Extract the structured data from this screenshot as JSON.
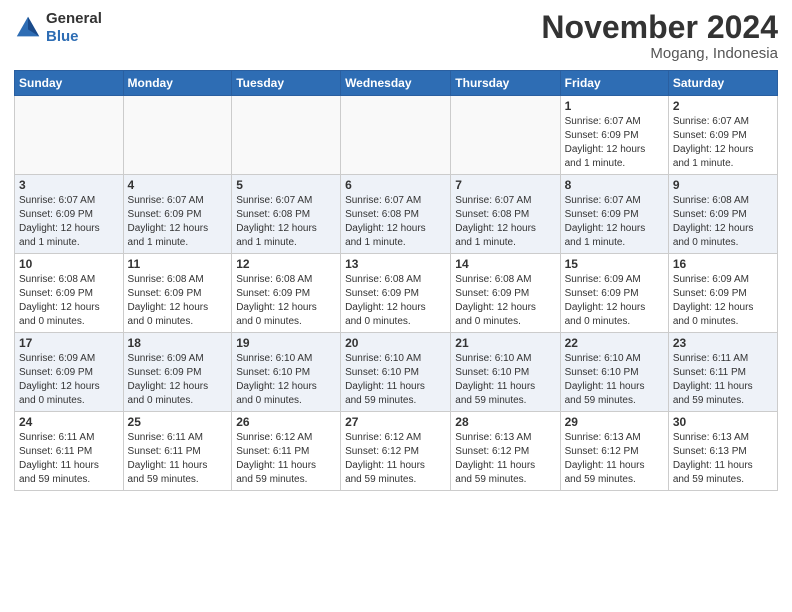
{
  "logo": {
    "line1": "General",
    "line2": "Blue"
  },
  "title": "November 2024",
  "location": "Mogang, Indonesia",
  "days_header": [
    "Sunday",
    "Monday",
    "Tuesday",
    "Wednesday",
    "Thursday",
    "Friday",
    "Saturday"
  ],
  "weeks": [
    [
      {
        "day": "",
        "info": ""
      },
      {
        "day": "",
        "info": ""
      },
      {
        "day": "",
        "info": ""
      },
      {
        "day": "",
        "info": ""
      },
      {
        "day": "",
        "info": ""
      },
      {
        "day": "1",
        "info": "Sunrise: 6:07 AM\nSunset: 6:09 PM\nDaylight: 12 hours\nand 1 minute."
      },
      {
        "day": "2",
        "info": "Sunrise: 6:07 AM\nSunset: 6:09 PM\nDaylight: 12 hours\nand 1 minute."
      }
    ],
    [
      {
        "day": "3",
        "info": "Sunrise: 6:07 AM\nSunset: 6:09 PM\nDaylight: 12 hours\nand 1 minute."
      },
      {
        "day": "4",
        "info": "Sunrise: 6:07 AM\nSunset: 6:09 PM\nDaylight: 12 hours\nand 1 minute."
      },
      {
        "day": "5",
        "info": "Sunrise: 6:07 AM\nSunset: 6:08 PM\nDaylight: 12 hours\nand 1 minute."
      },
      {
        "day": "6",
        "info": "Sunrise: 6:07 AM\nSunset: 6:08 PM\nDaylight: 12 hours\nand 1 minute."
      },
      {
        "day": "7",
        "info": "Sunrise: 6:07 AM\nSunset: 6:08 PM\nDaylight: 12 hours\nand 1 minute."
      },
      {
        "day": "8",
        "info": "Sunrise: 6:07 AM\nSunset: 6:09 PM\nDaylight: 12 hours\nand 1 minute."
      },
      {
        "day": "9",
        "info": "Sunrise: 6:08 AM\nSunset: 6:09 PM\nDaylight: 12 hours\nand 0 minutes."
      }
    ],
    [
      {
        "day": "10",
        "info": "Sunrise: 6:08 AM\nSunset: 6:09 PM\nDaylight: 12 hours\nand 0 minutes."
      },
      {
        "day": "11",
        "info": "Sunrise: 6:08 AM\nSunset: 6:09 PM\nDaylight: 12 hours\nand 0 minutes."
      },
      {
        "day": "12",
        "info": "Sunrise: 6:08 AM\nSunset: 6:09 PM\nDaylight: 12 hours\nand 0 minutes."
      },
      {
        "day": "13",
        "info": "Sunrise: 6:08 AM\nSunset: 6:09 PM\nDaylight: 12 hours\nand 0 minutes."
      },
      {
        "day": "14",
        "info": "Sunrise: 6:08 AM\nSunset: 6:09 PM\nDaylight: 12 hours\nand 0 minutes."
      },
      {
        "day": "15",
        "info": "Sunrise: 6:09 AM\nSunset: 6:09 PM\nDaylight: 12 hours\nand 0 minutes."
      },
      {
        "day": "16",
        "info": "Sunrise: 6:09 AM\nSunset: 6:09 PM\nDaylight: 12 hours\nand 0 minutes."
      }
    ],
    [
      {
        "day": "17",
        "info": "Sunrise: 6:09 AM\nSunset: 6:09 PM\nDaylight: 12 hours\nand 0 minutes."
      },
      {
        "day": "18",
        "info": "Sunrise: 6:09 AM\nSunset: 6:09 PM\nDaylight: 12 hours\nand 0 minutes."
      },
      {
        "day": "19",
        "info": "Sunrise: 6:10 AM\nSunset: 6:10 PM\nDaylight: 12 hours\nand 0 minutes."
      },
      {
        "day": "20",
        "info": "Sunrise: 6:10 AM\nSunset: 6:10 PM\nDaylight: 11 hours\nand 59 minutes."
      },
      {
        "day": "21",
        "info": "Sunrise: 6:10 AM\nSunset: 6:10 PM\nDaylight: 11 hours\nand 59 minutes."
      },
      {
        "day": "22",
        "info": "Sunrise: 6:10 AM\nSunset: 6:10 PM\nDaylight: 11 hours\nand 59 minutes."
      },
      {
        "day": "23",
        "info": "Sunrise: 6:11 AM\nSunset: 6:11 PM\nDaylight: 11 hours\nand 59 minutes."
      }
    ],
    [
      {
        "day": "24",
        "info": "Sunrise: 6:11 AM\nSunset: 6:11 PM\nDaylight: 11 hours\nand 59 minutes."
      },
      {
        "day": "25",
        "info": "Sunrise: 6:11 AM\nSunset: 6:11 PM\nDaylight: 11 hours\nand 59 minutes."
      },
      {
        "day": "26",
        "info": "Sunrise: 6:12 AM\nSunset: 6:11 PM\nDaylight: 11 hours\nand 59 minutes."
      },
      {
        "day": "27",
        "info": "Sunrise: 6:12 AM\nSunset: 6:12 PM\nDaylight: 11 hours\nand 59 minutes."
      },
      {
        "day": "28",
        "info": "Sunrise: 6:13 AM\nSunset: 6:12 PM\nDaylight: 11 hours\nand 59 minutes."
      },
      {
        "day": "29",
        "info": "Sunrise: 6:13 AM\nSunset: 6:12 PM\nDaylight: 11 hours\nand 59 minutes."
      },
      {
        "day": "30",
        "info": "Sunrise: 6:13 AM\nSunset: 6:13 PM\nDaylight: 11 hours\nand 59 minutes."
      }
    ]
  ]
}
